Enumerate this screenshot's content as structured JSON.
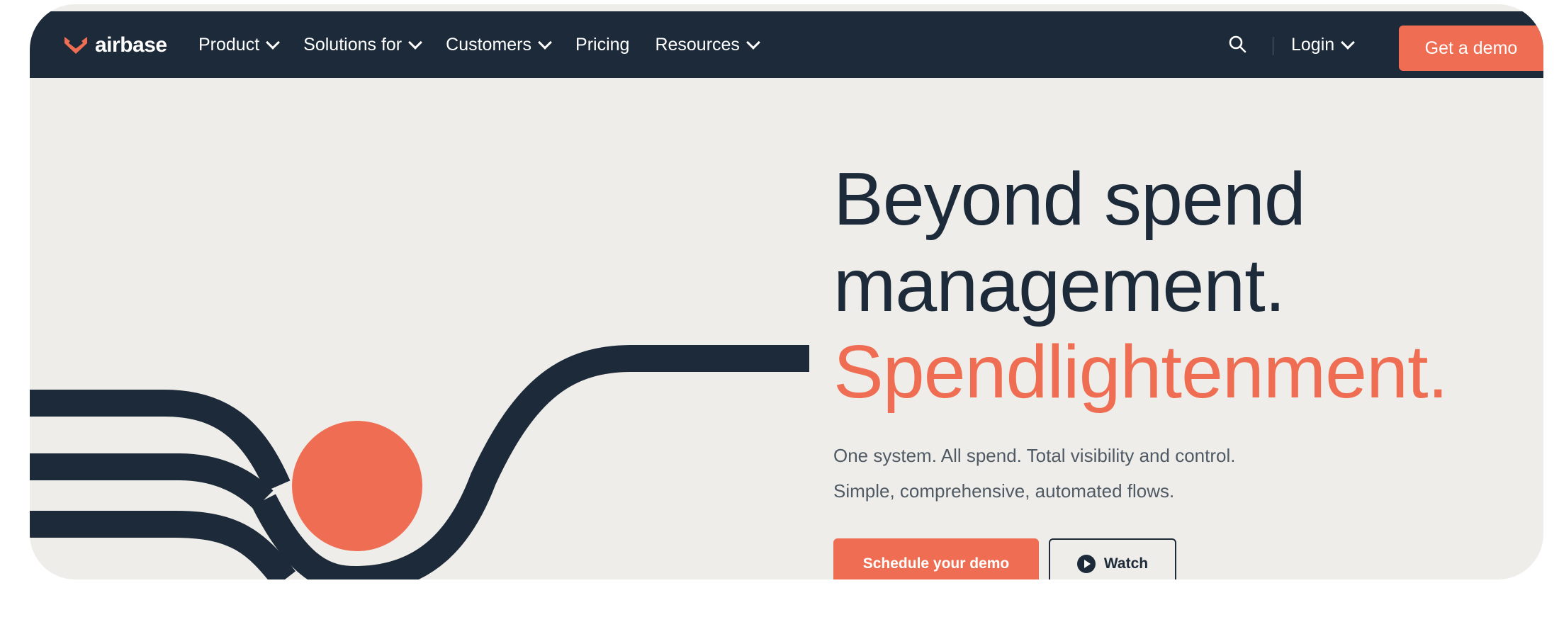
{
  "brand": {
    "name": "airbase",
    "color": "#ef6e53",
    "dark": "#1d2a39"
  },
  "nav": {
    "items": [
      {
        "label": "Product",
        "dropdown": true
      },
      {
        "label": "Solutions for",
        "dropdown": true
      },
      {
        "label": "Customers",
        "dropdown": true
      },
      {
        "label": "Pricing",
        "dropdown": false
      },
      {
        "label": "Resources",
        "dropdown": true
      }
    ],
    "search_icon": "search-icon",
    "login_label": "Login",
    "demo_label": "Get a demo"
  },
  "hero": {
    "headline_1": "Beyond spend",
    "headline_2": "management.",
    "headline_accent": "Spendlightenment.",
    "sub_1": "One system. All spend. Total visibility and control.",
    "sub_2": "Simple, comprehensive, automated flows.",
    "primary_cta": "Schedule your demo",
    "secondary_cta": "Watch"
  }
}
